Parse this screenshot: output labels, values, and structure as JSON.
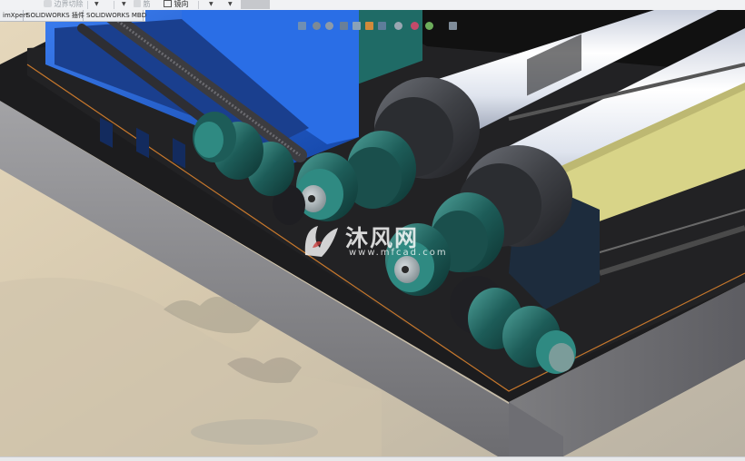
{
  "toolbar": {
    "items": [
      {
        "label": "边界切除",
        "icon": "boundary-cut-icon"
      },
      {
        "label": "筋",
        "icon": "rib-icon"
      },
      {
        "label": "镜向",
        "icon": "mirror-icon"
      }
    ]
  },
  "tabs": [
    {
      "label": "imXpert"
    },
    {
      "label": "SOLIDWORKS 插件"
    },
    {
      "label": "SOLIDWORKS MBD"
    }
  ],
  "heads_up_toolbar": {
    "icons": [
      "zoom-to-fit-icon",
      "zoom-area-icon",
      "previous-view-icon",
      "section-view-icon",
      "dynamic-annotation-icon",
      "view-orientation-icon",
      "display-style-icon",
      "hide-show-items-icon",
      "edit-appearance-icon",
      "apply-scene-icon",
      "view-settings-icon"
    ]
  },
  "watermark": {
    "brand": "沐风网",
    "url": "www.mfcad.com"
  },
  "colors": {
    "frame_blue": "#1e5fd1",
    "roller_teal": "#1f6b66",
    "roller_white": "#e8ecf5",
    "belt_yellow": "#d8d488",
    "base_grey": "#8a8a8c",
    "toolbar_bg": "#f1f2f4"
  }
}
